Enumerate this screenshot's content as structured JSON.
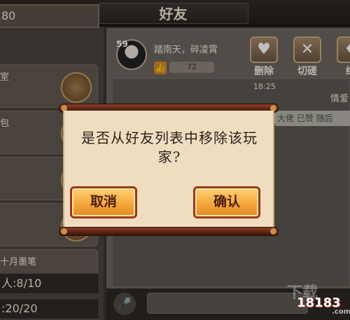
{
  "window": {
    "title": "好友"
  },
  "friend_list": {
    "header": "80",
    "rows": [
      {
        "name": "室"
      },
      {
        "name": "包"
      },
      {
        "name": ""
      },
      {
        "name": ""
      },
      {
        "name": "十月墨笔"
      }
    ],
    "stats": [
      {
        "label": "人:8/10"
      },
      {
        "label": ":20/20"
      }
    ]
  },
  "profile": {
    "level": "59",
    "motto": "踏南天，碎凌霄",
    "likes": "72",
    "actions": [
      {
        "label": "删除",
        "icon": "broken-heart-icon",
        "glyph": "♥"
      },
      {
        "label": "切磋",
        "icon": "crossed-swords-icon",
        "glyph": "✕"
      },
      {
        "label": "结",
        "icon": "bond-icon",
        "glyph": "♦"
      }
    ]
  },
  "chat": {
    "timestamp": "18:25",
    "partner_label": "情爱",
    "message": "大佬 已赞 随后"
  },
  "dialog": {
    "message": "是否从好友列表中移除该玩家?",
    "cancel_label": "取消",
    "confirm_label": "确认"
  },
  "watermark": {
    "brand_cn": "下载",
    "brand_num": "18183",
    "brand_suffix": ".com"
  },
  "colors": {
    "dialog_bg": "#f0ddbf",
    "button_gold": "#f4a73c",
    "button_border": "#9a3a1a",
    "scroll_rod": "#5a2414"
  }
}
